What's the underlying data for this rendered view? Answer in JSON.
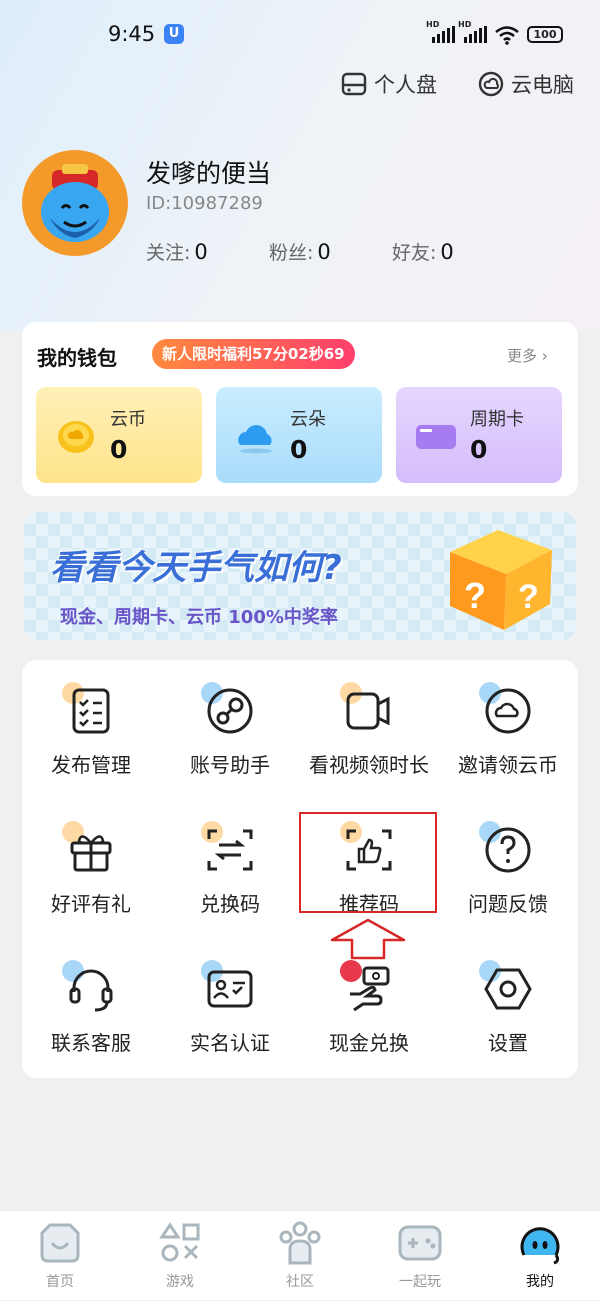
{
  "status": {
    "time": "9:45",
    "battery": "100"
  },
  "top_actions": {
    "disk": "个人盘",
    "cloud_pc": "云电脑"
  },
  "profile": {
    "name": "发嗲的便当",
    "id": "ID:10987289",
    "follow_label": "关注:",
    "follow_count": "0",
    "fans_label": "粉丝:",
    "fans_count": "0",
    "friends_label": "好友:",
    "friends_count": "0"
  },
  "wallet": {
    "title": "我的钱包",
    "promo": "新人限时福利57分02秒69",
    "more": "更多 ›",
    "items": [
      {
        "label": "云币",
        "value": "0"
      },
      {
        "label": "云朵",
        "value": "0"
      },
      {
        "label": "周期卡",
        "value": "0"
      }
    ]
  },
  "banner": {
    "title": "看看今天手气如何?",
    "subtitle": "现金、周期卡、云币 100%中奖率"
  },
  "grid": [
    {
      "label": "发布管理"
    },
    {
      "label": "账号助手"
    },
    {
      "label": "看视频领时长"
    },
    {
      "label": "邀请领云币"
    },
    {
      "label": "好评有礼"
    },
    {
      "label": "兑换码"
    },
    {
      "label": "推荐码"
    },
    {
      "label": "问题反馈"
    },
    {
      "label": "联系客服"
    },
    {
      "label": "实名认证"
    },
    {
      "label": "现金兑换"
    },
    {
      "label": "设置"
    }
  ],
  "tabs": [
    {
      "label": "首页"
    },
    {
      "label": "游戏"
    },
    {
      "label": "社区"
    },
    {
      "label": "一起玩"
    },
    {
      "label": "我的"
    }
  ],
  "colors": {
    "accent_highlight": "#d62828",
    "promo": "#ff3f6c",
    "orange_dot": "#ffd9a3",
    "blue_dot": "#a9d7f7"
  }
}
